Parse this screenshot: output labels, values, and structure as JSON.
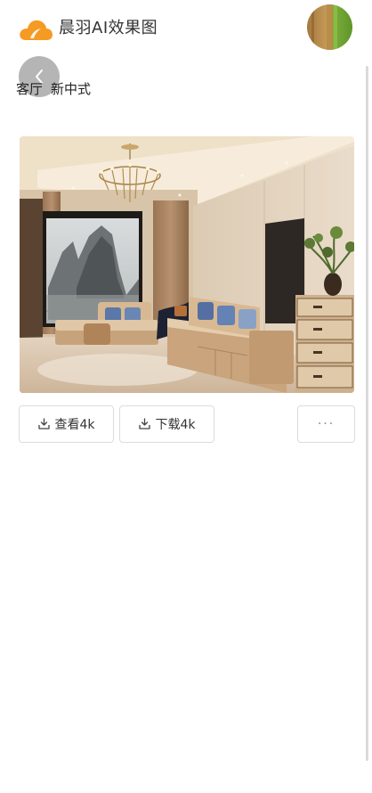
{
  "header": {
    "app_title": "晨羽AI效果图",
    "logo_icon": "orange-cloud-logo",
    "avatar_icon": "user-avatar"
  },
  "breadcrumb": {
    "back_icon": "chevron-left-icon",
    "room": "客厅",
    "style": "新中式"
  },
  "image": {
    "description_icon": "rendered-living-room-image"
  },
  "actions": {
    "view_label": "查看4k",
    "download_label": "下载4k",
    "more_label": "···",
    "download_icon": "download-tray-icon"
  },
  "colors": {
    "brand_orange": "#f59a23",
    "text": "#333333",
    "border": "#dcdcdc"
  }
}
